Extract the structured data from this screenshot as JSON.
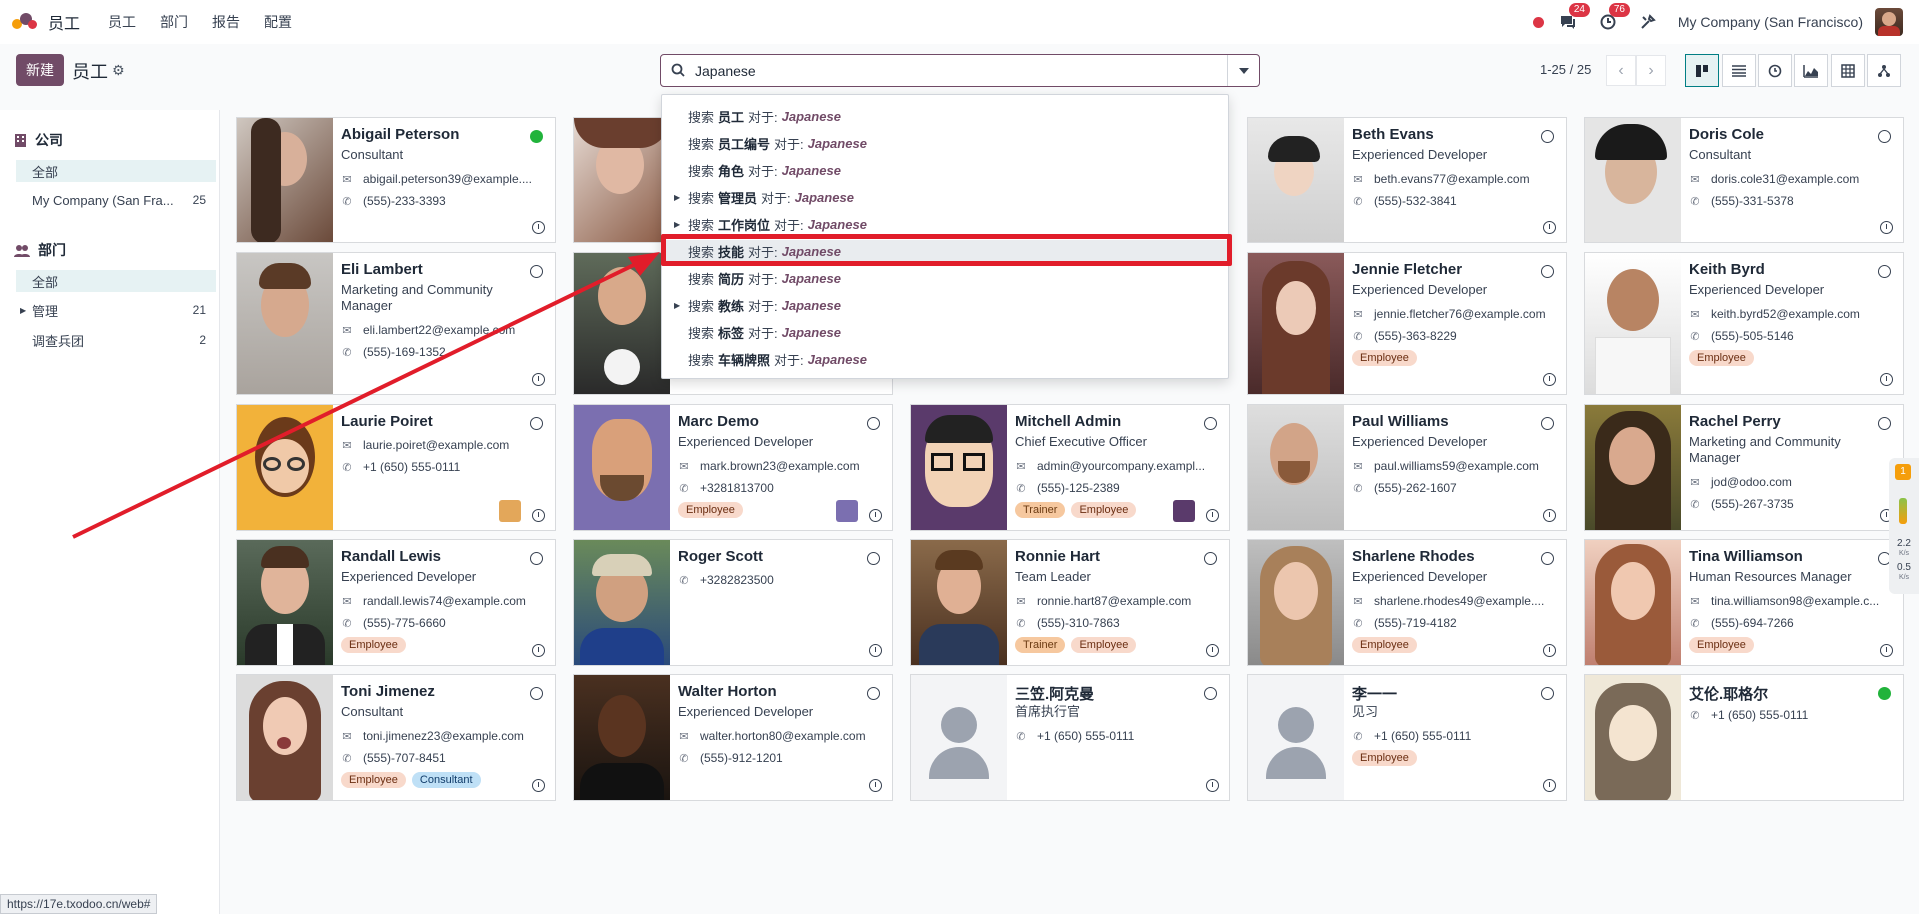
{
  "navbar": {
    "app_title": "员工",
    "menus": [
      "员工",
      "部门",
      "报告",
      "配置"
    ],
    "chat_badge": "24",
    "activity_badge": "76",
    "company": "My Company (San Francisco)"
  },
  "control": {
    "new_label": "新建",
    "breadcrumb": "员工",
    "search_value": "Japanese",
    "pager": "1-25 / 25"
  },
  "sidebar": {
    "company_head": "公司",
    "company_items": [
      {
        "label": "全部",
        "count": ""
      },
      {
        "label": "My Company (San Fra...",
        "count": "25"
      }
    ],
    "dept_head": "部门",
    "dept_items": [
      {
        "label": "全部",
        "count": ""
      },
      {
        "label": "管理",
        "count": "21"
      },
      {
        "label": "调查兵团",
        "count": "2"
      }
    ]
  },
  "dropdown": {
    "prefix": "搜索",
    "for_text": "对于:",
    "term": "Japanese",
    "items": [
      "员工",
      "员工编号",
      "角色",
      "管理员",
      "工作岗位",
      "技能",
      "简历",
      "教练",
      "标签",
      "车辆牌照"
    ]
  },
  "employees": [
    {
      "name": "Abigail Peterson",
      "job": "Consultant",
      "email": "abigail.peterson39@example....",
      "phone": "(555)-233-3393",
      "tags": []
    },
    {
      "name": "Beth Evans",
      "job": "Experienced Developer",
      "email": "beth.evans77@example.com",
      "phone": "(555)-532-3841",
      "tags": []
    },
    {
      "name": "Doris Cole",
      "job": "Consultant",
      "email": "doris.cole31@example.com",
      "phone": "(555)-331-5378",
      "tags": []
    },
    {
      "name": "Eli Lambert",
      "job": "Marketing and Community Manager",
      "email": "eli.lambert22@example.com",
      "phone": "(555)-169-1352",
      "tags": []
    },
    {
      "name": "Jennie Fletcher",
      "job": "Experienced Developer",
      "email": "jennie.fletcher76@example.com",
      "phone": "(555)-363-8229",
      "tags": [
        "Employee"
      ]
    },
    {
      "name": "Keith Byrd",
      "job": "Experienced Developer",
      "email": "keith.byrd52@example.com",
      "phone": "(555)-505-5146",
      "tags": [
        "Employee"
      ]
    },
    {
      "name": "Laurie Poiret",
      "job": "",
      "email": "laurie.poiret@example.com",
      "phone": "+1 (650) 555-0111",
      "tags": []
    },
    {
      "name": "Marc Demo",
      "job": "Experienced Developer",
      "email": "mark.brown23@example.com",
      "phone": "+3281813700",
      "tags": [
        "Employee"
      ]
    },
    {
      "name": "Mitchell Admin",
      "job": "Chief Executive Officer",
      "email": "admin@yourcompany.exampl...",
      "phone": "(555)-125-2389",
      "tags": [
        "Trainer",
        "Employee"
      ]
    },
    {
      "name": "Paul Williams",
      "job": "Experienced Developer",
      "email": "paul.williams59@example.com",
      "phone": "(555)-262-1607",
      "tags": []
    },
    {
      "name": "Rachel Perry",
      "job": "Marketing and Community Manager",
      "email": "jod@odoo.com",
      "phone": "(555)-267-3735",
      "tags": []
    },
    {
      "name": "Randall Lewis",
      "job": "Experienced Developer",
      "email": "randall.lewis74@example.com",
      "phone": "(555)-775-6660",
      "tags": [
        "Employee"
      ]
    },
    {
      "name": "Roger Scott",
      "job": "",
      "email": "",
      "phone": "+3282823500",
      "tags": []
    },
    {
      "name": "Ronnie Hart",
      "job": "Team Leader",
      "email": "ronnie.hart87@example.com",
      "phone": "(555)-310-7863",
      "tags": [
        "Trainer",
        "Employee"
      ]
    },
    {
      "name": "Sharlene Rhodes",
      "job": "Experienced Developer",
      "email": "sharlene.rhodes49@example....",
      "phone": "(555)-719-4182",
      "tags": [
        "Employee"
      ]
    },
    {
      "name": "Tina Williamson",
      "job": "Human Resources Manager",
      "email": "tina.williamson98@example.c...",
      "phone": "(555)-694-7266",
      "tags": [
        "Employee"
      ]
    },
    {
      "name": "Toni Jimenez",
      "job": "Consultant",
      "email": "toni.jimenez23@example.com",
      "phone": "(555)-707-8451",
      "tags": [
        "Employee",
        "Consultant"
      ]
    },
    {
      "name": "Walter Horton",
      "job": "Experienced Developer",
      "email": "walter.horton80@example.com",
      "phone": "(555)-912-1201",
      "tags": []
    },
    {
      "name": "三笠.阿克曼",
      "job": "首席执行官",
      "email": "",
      "phone": "+1 (650) 555-0111",
      "tags": []
    },
    {
      "name": "李一一",
      "job": "见习",
      "email": "",
      "phone": "+1 (650) 555-0111",
      "tags": [
        "Employee"
      ]
    },
    {
      "name": "艾伦.耶格尔",
      "job": "",
      "email": "",
      "phone": "+1 (650) 555-0111",
      "tags": []
    }
  ],
  "widget": {
    "up": "2.2",
    "up_unit": "K/s",
    "down": "0.5",
    "down_unit": "K/s",
    "count": "1"
  },
  "status_url": "https://17e.txodoo.cn/web#",
  "colors": {
    "brand": "#714b67",
    "accent": "#017e84",
    "annotation": "#e11d2a",
    "online": "#21b33b"
  }
}
